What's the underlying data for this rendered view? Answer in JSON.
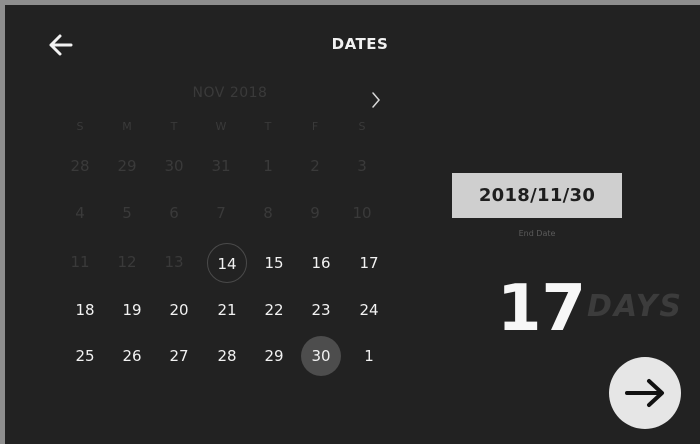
{
  "header": {
    "title": "DATES",
    "back_icon": "arrow-left-icon"
  },
  "calendar": {
    "month_label": "NOV 2018",
    "next_icon": "chevron-right-icon",
    "weekdays": [
      "S",
      "M",
      "T",
      "W",
      "T",
      "F",
      "S"
    ],
    "weeks": [
      [
        "28",
        "29",
        "30",
        "31",
        "1",
        "2",
        "3"
      ],
      [
        "4",
        "5",
        "6",
        "7",
        "8",
        "9",
        "10"
      ],
      [
        "11",
        "12",
        "13",
        "14",
        "15",
        "16",
        "17"
      ],
      [
        "18",
        "19",
        "20",
        "21",
        "22",
        "23",
        "24"
      ],
      [
        "25",
        "26",
        "27",
        "28",
        "29",
        "30",
        "1"
      ]
    ],
    "selected_start": "14",
    "selected_end": "30"
  },
  "summary": {
    "end_date": "2018/11/30",
    "end_date_label": "End Date",
    "days_count": "17",
    "days_unit": "DAYS"
  },
  "actions": {
    "confirm_icon": "arrow-right-icon"
  },
  "colors": {
    "background": "#222222",
    "text": "#f2f2f2",
    "dim_text": "#3a3a3a",
    "end_date_box": "#cfcfcf",
    "confirm_button": "#e6e6e6"
  }
}
